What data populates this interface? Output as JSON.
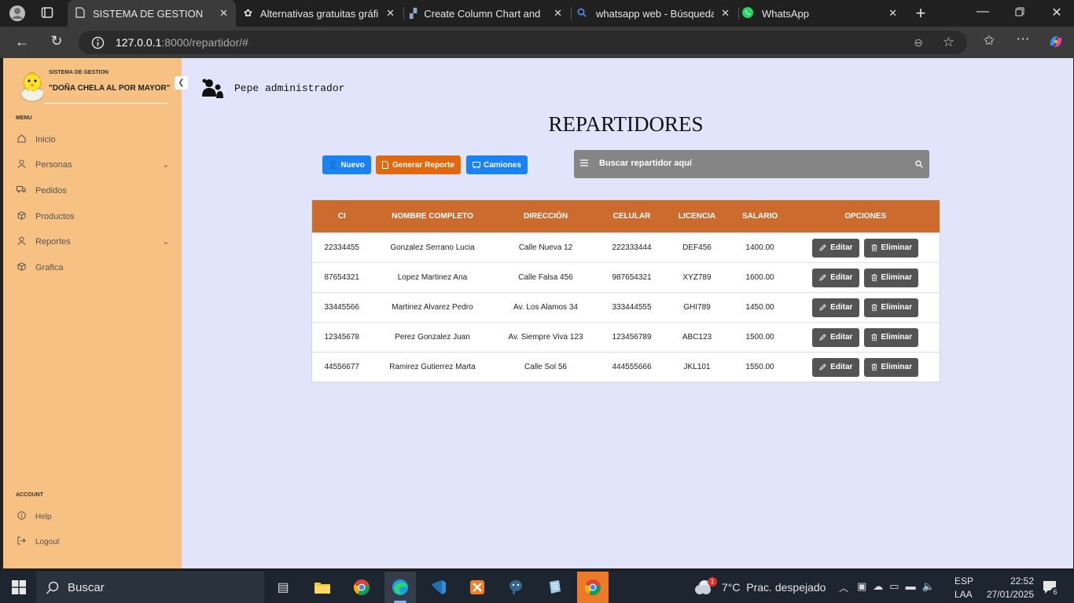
{
  "browser": {
    "tabs": [
      {
        "label": "SISTEMA DE GESTION",
        "active": true
      },
      {
        "label": "Alternativas gratuitas gráfica",
        "active": false
      },
      {
        "label": "Create Column Chart and Gr",
        "active": false
      },
      {
        "label": "whatsapp web - Búsqueda",
        "active": false
      },
      {
        "label": "WhatsApp",
        "active": false
      }
    ],
    "url_host": "127.0.0.1",
    "url_path": ":8000/repartidor/#"
  },
  "sidebar": {
    "brand_small": "SISTEMA DE GESTION",
    "brand_name": "\"DOÑA CHELA AL POR MAYOR\"",
    "menu_header": "MENU",
    "items": [
      {
        "label": "Inicio",
        "icon": "home-icon"
      },
      {
        "label": "Personas",
        "icon": "user-icon"
      },
      {
        "label": "Pedidos",
        "icon": "truck-icon"
      },
      {
        "label": "Productos",
        "icon": "box-icon"
      },
      {
        "label": "Reportes",
        "icon": "user-icon"
      },
      {
        "label": "Grafica",
        "icon": "box-icon"
      }
    ],
    "account_header": "ACCOUNT",
    "account_items": [
      {
        "label": "Help",
        "icon": "help-icon"
      },
      {
        "label": "Logout",
        "icon": "logout-icon"
      }
    ]
  },
  "header": {
    "user": "Pepe administrador"
  },
  "page": {
    "title": "REPARTIDORES",
    "buttons": {
      "nuevo": "Nuevo",
      "reporte": "Generar Reporte",
      "camiones": "Camiones"
    },
    "search_placeholder": "Buscar repartidor aquí",
    "colors": {
      "sidebar": "#f7c183",
      "table_header": "#cd6a2e",
      "nuevo": "#1a82f2",
      "reporte": "#e06811",
      "camiones": "#1a82f2",
      "background": "#e1e4fb"
    }
  },
  "table": {
    "columns": [
      "CI",
      "NOMBRE COMPLETO",
      "DIRECCIÓN",
      "CELULAR",
      "LICENCIA",
      "SALARIO",
      "OPCIONES"
    ],
    "edit_label": "Editar",
    "delete_label": "Eliminar",
    "rows": [
      [
        "22334455",
        "Gonzalez Serrano Lucia",
        "Calle Nueva 12",
        "222333444",
        "DEF456",
        "1400.00"
      ],
      [
        "87654321",
        "Lopez Martinez Ana",
        "Calle Falsa 456",
        "987654321",
        "XYZ789",
        "1600.00"
      ],
      [
        "33445566",
        "Martinez Alvarez Pedro",
        "Av. Los Alamos 34",
        "333444555",
        "GHI789",
        "1450.00"
      ],
      [
        "12345678",
        "Perez Gonzalez Juan",
        "Av. Siempre Viva 123",
        "123456789",
        "ABC123",
        "1500.00"
      ],
      [
        "44556677",
        "Ramirez Gutierrez Marta",
        "Calle Sol 56",
        "444555666",
        "JKL101",
        "1550.00"
      ]
    ]
  },
  "taskbar": {
    "search": "Buscar",
    "weather": "7°C  Prac. despejado",
    "lang1": "ESP",
    "lang2": "LAA",
    "time": "22:52",
    "date": "27/01/2025",
    "notif": "6",
    "weather_badge": "1"
  }
}
